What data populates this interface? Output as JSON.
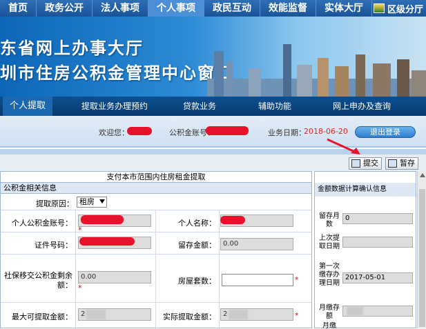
{
  "topnav": {
    "items": [
      "首页",
      "政务公开",
      "法人事项",
      "个人事项",
      "政民互动",
      "效能监督",
      "实体大厅"
    ],
    "active_index": 3,
    "district": "区级分厅"
  },
  "banner": {
    "line1": "东省网上办事大厅",
    "line2": "圳市住房公积金管理中心窗口"
  },
  "subnav": {
    "items": [
      "个人提取",
      "提取业务办理预约",
      "贷款业务",
      "辅助功能",
      "网上申办及查询"
    ]
  },
  "userbar": {
    "welcome_label": "欢迎您：",
    "account_label": "公积金账号：",
    "date_label": "业务日期：",
    "date_value": "2018-06-20",
    "logout_label": "退出登录"
  },
  "toolbar": {
    "submit_label": "提交",
    "save_label": "暂存"
  },
  "form": {
    "title": "支付本市范围内住房租金提取",
    "section": "公积金相关信息",
    "reason_label": "提取原因：",
    "reason_value": "租房",
    "account_no_label": "个人公积金账号：",
    "name_label": "个人名称：",
    "id_label": "证件号码：",
    "balance_label": "留存金额：",
    "balance_value": "0.00",
    "transfer_label": "社保移交公积金剩余额：",
    "transfer_value": "0.00",
    "house_count_label": "房屋套数：",
    "max_label": "最大可提取金额：",
    "max_value": "2",
    "actual_label": "实际提取金额：",
    "actual_value": "2",
    "required_mark": "*"
  },
  "right": {
    "header": "金额数据计算确认信息",
    "rows": [
      {
        "label": "留存月数",
        "value": "0"
      },
      {
        "label": "上次提取日期",
        "value": ""
      },
      {
        "label": "第一次缴存办理日期",
        "value": "2017-05-01"
      },
      {
        "label": "月缴存额",
        "value": ""
      },
      {
        "label": "月缴",
        "value": ""
      }
    ]
  },
  "colors": {
    "topnav": "#1a5398",
    "subnav": "#083a6d",
    "date_red": "#d9261c",
    "redact": "#e8112a"
  }
}
